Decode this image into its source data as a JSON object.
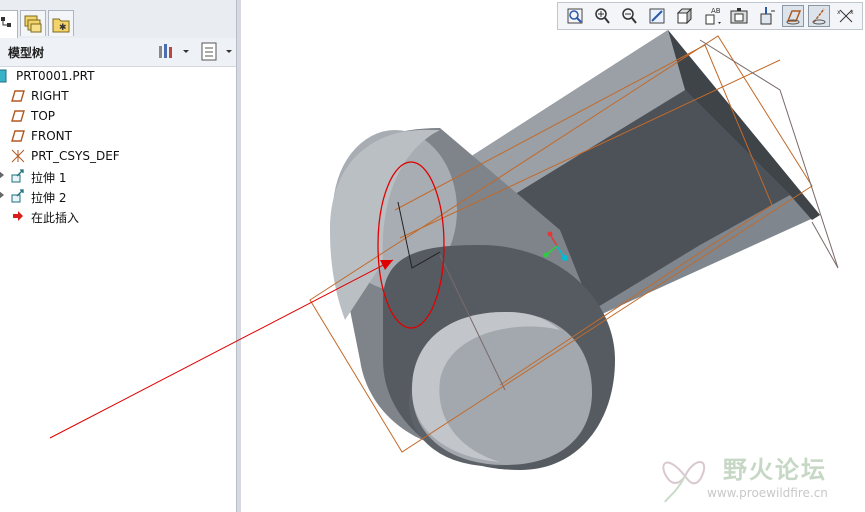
{
  "model_tree": {
    "title": "模型树",
    "items": [
      {
        "label": "PRT0001.PRT",
        "icon": "part-icon",
        "indent": 0,
        "expandable": false
      },
      {
        "label": "RIGHT",
        "icon": "datum-plane-icon",
        "indent": 1,
        "expandable": false
      },
      {
        "label": "TOP",
        "icon": "datum-plane-icon",
        "indent": 1,
        "expandable": false
      },
      {
        "label": "FRONT",
        "icon": "datum-plane-icon",
        "indent": 1,
        "expandable": false
      },
      {
        "label": "PRT_CSYS_DEF",
        "icon": "csys-icon",
        "indent": 1,
        "expandable": false
      },
      {
        "label": "拉伸 1",
        "icon": "extrude-icon",
        "indent": 1,
        "expandable": true
      },
      {
        "label": "拉伸 2",
        "icon": "extrude-icon",
        "indent": 1,
        "expandable": true
      },
      {
        "label": "在此插入",
        "icon": "insert-here-arrow-icon",
        "indent": 1,
        "expandable": false
      }
    ]
  },
  "tabs": [
    "model-tree-tab",
    "layers-tab",
    "favorites-tab"
  ],
  "toolbar": {
    "buttons": [
      "refit-icon",
      "zoom-in-icon",
      "zoom-out-icon",
      "repaint-icon",
      "view-orient-icon",
      "saved-views-icon",
      "view-manager-icon",
      "spin-center-icon",
      "datum-planes-display-icon",
      "datum-axes-display-icon",
      "csys-display-icon"
    ]
  },
  "colors": {
    "model_body": "#5f656b",
    "model_dark_face": "#474c52",
    "datum_plane": "#c26a2a",
    "annotation_red": "#e00000",
    "csys_x": "#e53935",
    "csys_y": "#2ecc40",
    "csys_z": "#00bcd4"
  },
  "watermark": {
    "title": "野火论坛",
    "url": "www.proewildfire.cn"
  }
}
